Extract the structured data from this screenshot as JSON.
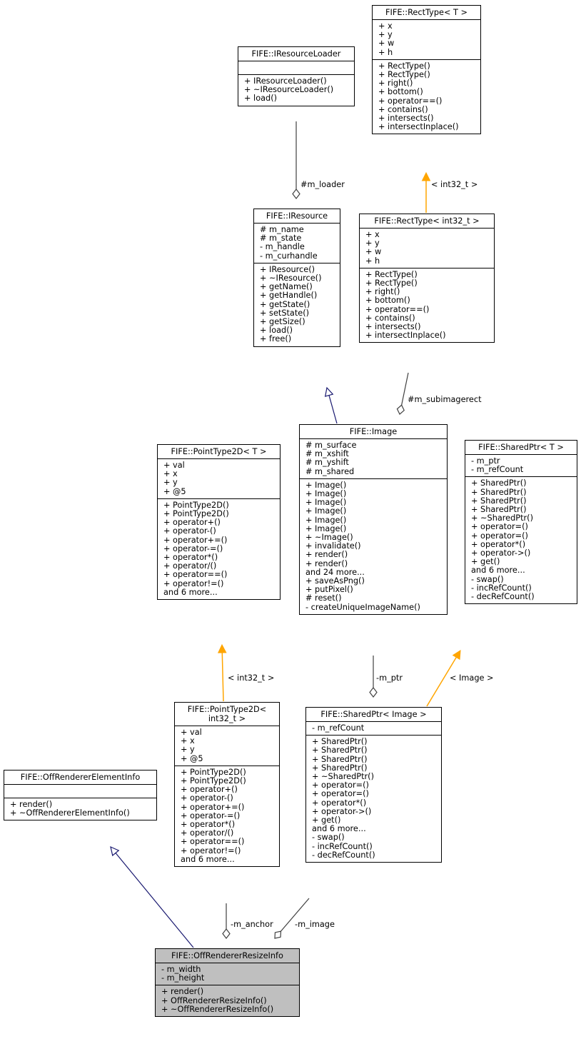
{
  "diagram": {
    "type": "uml-class-collaboration",
    "colors": {
      "inheritance": "#191970",
      "template": "#ffa500",
      "aggregation": "#404040",
      "focus_fill": "#bfbfbf",
      "node_fill": "#ffffff"
    },
    "nodes": {
      "recttype_t": {
        "title": "FIFE::RectType< T >",
        "attributes": [
          "+ x",
          "+ y",
          "+ w",
          "+ h"
        ],
        "methods": [
          "+ RectType()",
          "+ RectType()",
          "+ right()",
          "+ bottom()",
          "+ operator==()",
          "+ contains()",
          "+ intersects()",
          "+ intersectInplace()"
        ]
      },
      "iresourceloader": {
        "title": "FIFE::IResourceLoader",
        "attributes": [],
        "methods": [
          "+ IResourceLoader()",
          "+ ~IResourceLoader()",
          "+ load()"
        ]
      },
      "iresource": {
        "title": "FIFE::IResource",
        "attributes": [
          "# m_name",
          "# m_state",
          "- m_handle",
          "- m_curhandle"
        ],
        "methods": [
          "+ IResource()",
          "+ ~IResource()",
          "+ getName()",
          "+ getHandle()",
          "+ getState()",
          "+ setState()",
          "+ getSize()",
          "+ load()",
          "+ free()"
        ]
      },
      "recttype_int32": {
        "title": "FIFE::RectType< int32_t >",
        "attributes": [
          "+ x",
          "+ y",
          "+ w",
          "+ h"
        ],
        "methods": [
          "+ RectType()",
          "+ RectType()",
          "+ right()",
          "+ bottom()",
          "+ operator==()",
          "+ contains()",
          "+ intersects()",
          "+ intersectInplace()"
        ]
      },
      "image": {
        "title": "FIFE::Image",
        "attributes": [
          "# m_surface",
          "# m_xshift",
          "# m_yshift",
          "# m_shared"
        ],
        "methods": [
          "+ Image()",
          "+ Image()",
          "+ Image()",
          "+ Image()",
          "+ Image()",
          "+ Image()",
          "+ ~Image()",
          "+ invalidate()",
          "+ render()",
          "+ render()",
          "and 24 more...",
          "+ saveAsPng()",
          "+ putPixel()",
          "# reset()",
          "- createUniqueImageName()"
        ]
      },
      "pointtype2d_t": {
        "title": "FIFE::PointType2D< T >",
        "attributes": [
          "+ val",
          "+ x",
          "+ y",
          "+ @5"
        ],
        "methods": [
          "+ PointType2D()",
          "+ PointType2D()",
          "+ operator+()",
          "+ operator-()",
          "+ operator+=()",
          "+ operator-=()",
          "+ operator*()",
          "+ operator/()",
          "+ operator==()",
          "+ operator!=()",
          "and 6 more..."
        ]
      },
      "sharedptr_t": {
        "title": "FIFE::SharedPtr< T >",
        "attributes": [
          "- m_ptr",
          "- m_refCount"
        ],
        "methods": [
          "+ SharedPtr()",
          "+ SharedPtr()",
          "+ SharedPtr()",
          "+ SharedPtr()",
          "+ ~SharedPtr()",
          "+ operator=()",
          "+ operator=()",
          "+ operator*()",
          "+ operator->()",
          "+ get()",
          "and 6 more...",
          "- swap()",
          "- incRefCount()",
          "- decRefCount()"
        ]
      },
      "pointtype2d_int32": {
        "title": "FIFE::PointType2D<\nint32_t >",
        "attributes": [
          "+ val",
          "+ x",
          "+ y",
          "+ @5"
        ],
        "methods": [
          "+ PointType2D()",
          "+ PointType2D()",
          "+ operator+()",
          "+ operator-()",
          "+ operator+=()",
          "+ operator-=()",
          "+ operator*()",
          "+ operator/()",
          "+ operator==()",
          "+ operator!=()",
          "and 6 more..."
        ]
      },
      "sharedptr_image": {
        "title": "FIFE::SharedPtr< Image >",
        "attributes": [
          "- m_refCount"
        ],
        "methods": [
          "+ SharedPtr()",
          "+ SharedPtr()",
          "+ SharedPtr()",
          "+ SharedPtr()",
          "+ ~SharedPtr()",
          "+ operator=()",
          "+ operator=()",
          "+ operator*()",
          "+ operator->()",
          "+ get()",
          "and 6 more...",
          "- swap()",
          "- incRefCount()",
          "- decRefCount()"
        ]
      },
      "offrendererelementinfo": {
        "title": "FIFE::OffRendererElementInfo",
        "attributes": [],
        "methods": [
          "+ render()",
          "+ ~OffRendererElementInfo()"
        ]
      },
      "offrendererresizeinfo": {
        "title": "FIFE::OffRendererResizeInfo",
        "attributes": [
          "- m_width",
          "- m_height"
        ],
        "methods": [
          "+ render()",
          "+ OffRendererResizeInfo()",
          "+ ~OffRendererResizeInfo()"
        ],
        "focus": true
      }
    },
    "edges": [
      {
        "from": "recttype_int32",
        "to": "recttype_t",
        "kind": "template",
        "label": "< int32_t >"
      },
      {
        "from": "iresource",
        "to": "iresourceloader",
        "kind": "aggregation",
        "label": "#m_loader"
      },
      {
        "from": "image",
        "to": "iresource",
        "kind": "inheritance",
        "label": ""
      },
      {
        "from": "image",
        "to": "recttype_int32",
        "kind": "aggregation",
        "label": "#m_subimagerect"
      },
      {
        "from": "pointtype2d_int32",
        "to": "pointtype2d_t",
        "kind": "template",
        "label": "< int32_t >"
      },
      {
        "from": "sharedptr_image",
        "to": "image",
        "kind": "aggregation",
        "label": "-m_ptr"
      },
      {
        "from": "sharedptr_image",
        "to": "sharedptr_t",
        "kind": "template",
        "label": "< Image >"
      },
      {
        "from": "offrendererresizeinfo",
        "to": "offrendererelementinfo",
        "kind": "inheritance",
        "label": ""
      },
      {
        "from": "offrendererresizeinfo",
        "to": "pointtype2d_int32",
        "kind": "aggregation",
        "label": "-m_anchor"
      },
      {
        "from": "offrendererresizeinfo",
        "to": "sharedptr_image",
        "kind": "aggregation",
        "label": "-m_image"
      }
    ]
  }
}
